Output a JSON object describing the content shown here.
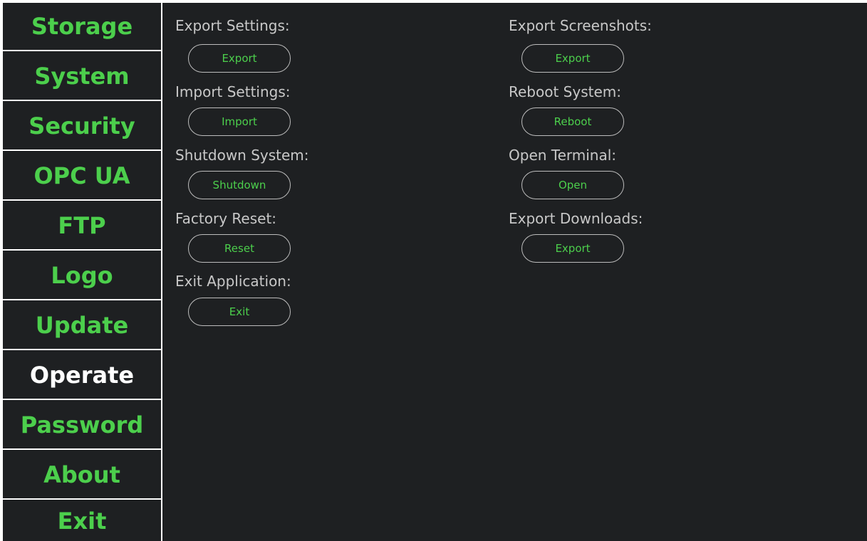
{
  "sidebar": {
    "items": [
      {
        "label": "Storage"
      },
      {
        "label": "System"
      },
      {
        "label": "Security"
      },
      {
        "label": "OPC UA"
      },
      {
        "label": "FTP"
      },
      {
        "label": "Logo"
      },
      {
        "label": "Update"
      },
      {
        "label": "Operate"
      },
      {
        "label": "Password"
      },
      {
        "label": "About"
      },
      {
        "label": "Exit"
      }
    ],
    "active": "Operate"
  },
  "main": {
    "left": [
      {
        "label": "Export Settings:",
        "button": "Export"
      },
      {
        "label": "Import Settings:",
        "button": "Import"
      },
      {
        "label": "Shutdown System:",
        "button": "Shutdown"
      },
      {
        "label": "Factory Reset:",
        "button": "Reset"
      },
      {
        "label": "Exit Application:",
        "button": "Exit"
      }
    ],
    "right": [
      {
        "label": "Export Screenshots:",
        "button": "Export"
      },
      {
        "label": "Reboot System:",
        "button": "Reboot"
      },
      {
        "label": "Open Terminal:",
        "button": "Open"
      },
      {
        "label": "Export Downloads:",
        "button": "Export"
      }
    ]
  },
  "colors": {
    "background": "#1e2022",
    "accent": "#4ccf4c",
    "active_text": "#ffffff",
    "label_text": "#c8c8c8"
  }
}
